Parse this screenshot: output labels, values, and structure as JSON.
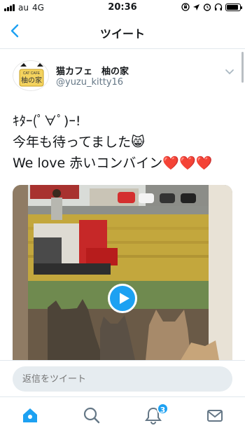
{
  "status_bar": {
    "carrier": "au",
    "network": "4G",
    "time": "20:36",
    "battery_level": 0.9
  },
  "nav": {
    "title": "ツイート"
  },
  "tweet": {
    "user_name": "猫カフェ　柚の家",
    "handle": "@yuzu_kitty16",
    "lines": [
      "ｷﾀｰ(ﾟ∀ﾟ)ｰ!",
      "今年も待ってました😸",
      "We love 赤いコンバイン"
    ],
    "hearts": "❤️❤️❤️",
    "avatar_text": "CAT CAFE"
  },
  "reply": {
    "placeholder": "返信をツイート"
  },
  "tabs": {
    "notifications_badge": "3"
  },
  "colors": {
    "accent": "#1da1f2",
    "heart": "#e0245e"
  }
}
